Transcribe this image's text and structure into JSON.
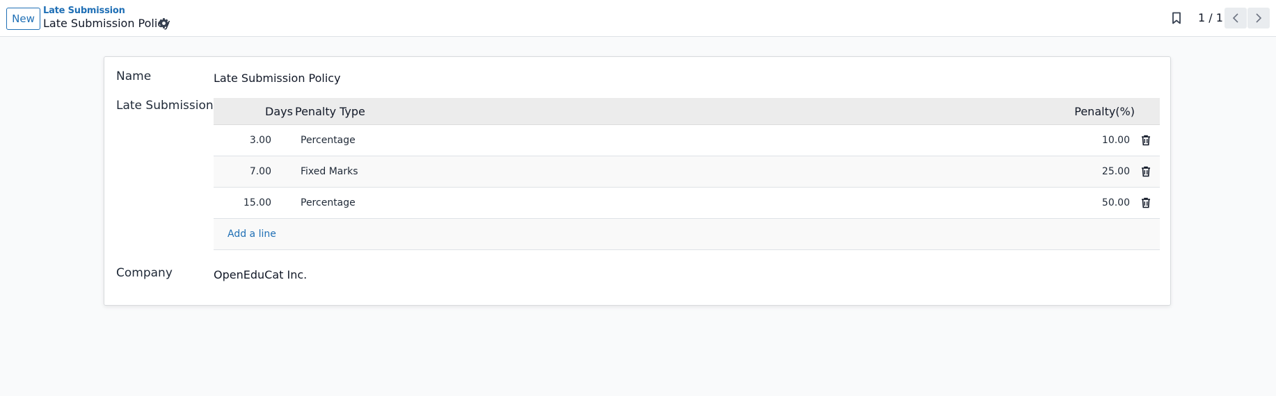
{
  "control_panel": {
    "new_label": "New",
    "breadcrumb": "Late Submission",
    "record_title": "Late Submission Policy",
    "pager": "1 / 1"
  },
  "form": {
    "name_label": "Name",
    "name_value": "Late Submission Policy",
    "late_label": "Late Submission",
    "company_label": "Company",
    "company_value": "OpenEduCat Inc.",
    "columns": {
      "days": "Days",
      "penalty_type": "Penalty Type",
      "penalty": "Penalty(%)"
    },
    "rows": [
      {
        "days": "3.00",
        "type": "Percentage",
        "penalty": "10.00"
      },
      {
        "days": "7.00",
        "type": "Fixed Marks",
        "penalty": "25.00"
      },
      {
        "days": "15.00",
        "type": "Percentage",
        "penalty": "50.00"
      }
    ],
    "add_line": "Add a line"
  },
  "colors": {
    "link": "#1f6fb5",
    "header_bg": "#ececec",
    "page_bg": "#f9fafb"
  },
  "icons": [
    "gear-icon",
    "bookmark-icon",
    "chevron-left-icon",
    "chevron-right-icon",
    "trash-icon"
  ]
}
